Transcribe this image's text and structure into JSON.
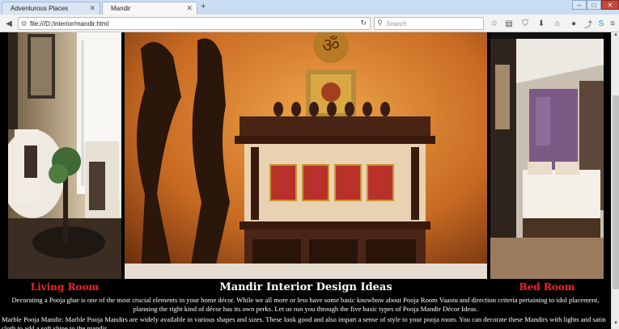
{
  "browser": {
    "tabs": [
      {
        "label": "Adventurous Places",
        "active": false
      },
      {
        "label": "Mandir",
        "active": true
      }
    ],
    "url": "file:///D:/interior/mandir.html",
    "search_placeholder": "Search",
    "icons": [
      "back-icon",
      "reload-icon",
      "search-icon",
      "star-icon",
      "reading-list-icon",
      "pocket-icon",
      "download-icon",
      "home-icon",
      "chat-icon",
      "share-icon",
      "skype-icon",
      "menu-icon"
    ]
  },
  "page": {
    "captions": {
      "living_room": "Living Room",
      "main_title": "Mandir Interior Design Ideas",
      "bed_room": "Bed Room"
    },
    "paragraphs": {
      "intro": "Decorating a Pooja ghar is one of the most crucial elements in your home décor. While we all more or less have some basic knowhow about Pooja Room Vaastu and direction criteria pertaining to idol placement, planning the right kind of décor has its own perks. Let us run you through the five basic types of Pooja Mandir Décor Ideas.",
      "marble": "Marble Pooja Mandir: Marble Pooja Mandirs are widely available in various shapes and sizes. These look good and also impart a sense of style to your pooja room. You can decorate these Mandirs with lights and satin cloth to add a soft shine to the mandir."
    },
    "colors": {
      "caption_red": "#ff1e1e",
      "background": "#000000",
      "text": "#ffffff"
    }
  }
}
